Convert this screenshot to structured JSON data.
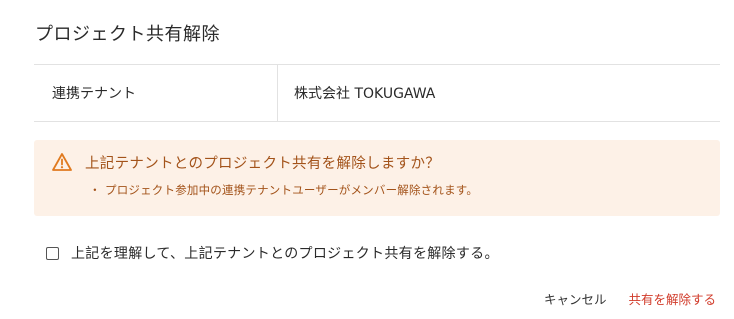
{
  "dialog": {
    "title": "プロジェクト共有解除"
  },
  "info": {
    "label": "連携テナント",
    "value": "株式会社 TOKUGAWA"
  },
  "warning": {
    "icon": "warning-triangle-icon",
    "color": "#a3531a",
    "background": "#fdf1e7",
    "message": "上記テナントとのプロジェクト共有を解除しますか？",
    "bullet": "・",
    "detail": "プロジェクト参加中の連携テナントユーザーがメンバー解除されます。"
  },
  "confirm": {
    "checked": false,
    "label": "上記を理解して、上記テナントとのプロジェクト共有を解除する。"
  },
  "actions": {
    "cancel_label": "キャンセル",
    "confirm_label": "共有を解除する",
    "danger_color": "#d13b2a"
  }
}
